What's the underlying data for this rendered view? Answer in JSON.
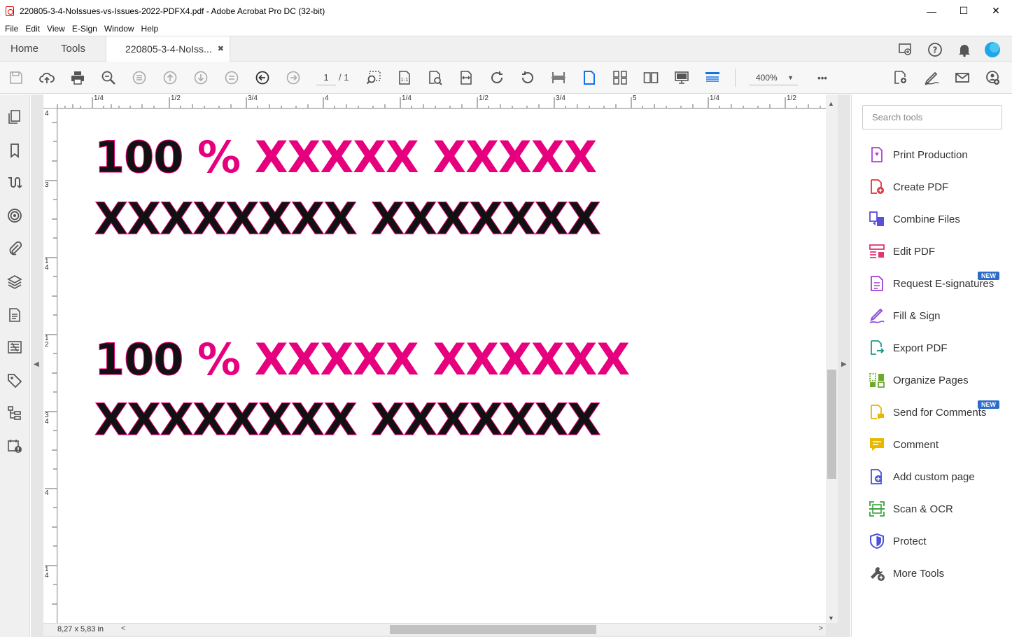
{
  "window": {
    "title": "220805-3-4-NoIssues-vs-Issues-2022-PDFX4.pdf - Adobe Acrobat Pro DC (32-bit)",
    "minimize": "—",
    "maximize": "☐",
    "close": "✕"
  },
  "menu": [
    "File",
    "Edit",
    "View",
    "E-Sign",
    "Window",
    "Help"
  ],
  "tabs": {
    "home": "Home",
    "tools": "Tools",
    "document": "220805-3-4-NoIss...",
    "document_close": "✖"
  },
  "toolbar": {
    "page_current": "1",
    "page_total": "/ 1",
    "zoom": "400%",
    "more": "•••"
  },
  "rulers": {
    "horizontal": [
      "1/4",
      "1/2",
      "3/4",
      "4",
      "1/4",
      "1/2",
      "3/4",
      "5",
      "1/4",
      "1/2"
    ],
    "vertical": [
      "4",
      "3",
      "1\n4",
      "1\n2",
      "3\n4",
      "4",
      "1\n4"
    ]
  },
  "document": {
    "lines": [
      {
        "dark": "100",
        "pink": " % XXXXX XXXXX"
      },
      {
        "dark": "XXXXXXXX XXXXXXX",
        "pink": ""
      },
      {
        "dark": "100",
        "pink": " % XXXXX XXXXXX"
      },
      {
        "dark": "XXXXXXXX XXXXXXX",
        "pink": ""
      }
    ]
  },
  "status": {
    "dimensions": "8,27 x 5,83 in",
    "scroll_left": "<",
    "scroll_right": ">"
  },
  "right_pane": {
    "search_placeholder": "Search tools",
    "new_badge": "NEW",
    "tools": [
      {
        "label": "Print Production",
        "icon": "print-production-icon",
        "color": "#b13fd6"
      },
      {
        "label": "Create PDF",
        "icon": "create-pdf-icon",
        "color": "#e0343b"
      },
      {
        "label": "Combine Files",
        "icon": "combine-files-icon",
        "color": "#5b4fd8"
      },
      {
        "label": "Edit PDF",
        "icon": "edit-pdf-icon",
        "color": "#e03474"
      },
      {
        "label": "Request E-signatures",
        "icon": "request-esignatures-icon",
        "color": "#a23fd6",
        "badge": true
      },
      {
        "label": "Fill & Sign",
        "icon": "fill-sign-icon",
        "color": "#8b4fd8"
      },
      {
        "label": "Export PDF",
        "icon": "export-pdf-icon",
        "color": "#1e9a8a"
      },
      {
        "label": "Organize Pages",
        "icon": "organize-pages-icon",
        "color": "#6cab2a"
      },
      {
        "label": "Send for Comments",
        "icon": "send-for-comments-icon",
        "color": "#e8b800",
        "badge": true
      },
      {
        "label": "Comment",
        "icon": "comment-icon",
        "color": "#e8b800"
      },
      {
        "label": "Add custom page",
        "icon": "add-custom-page-icon",
        "color": "#4b52d8"
      },
      {
        "label": "Scan & OCR",
        "icon": "scan-ocr-icon",
        "color": "#3ca43c"
      },
      {
        "label": "Protect",
        "icon": "protect-icon",
        "color": "#4b52d8"
      },
      {
        "label": "More Tools",
        "icon": "more-tools-icon",
        "color": "#555555"
      }
    ]
  },
  "colors": {
    "accent_pink": "#e6007e",
    "text_dark": "#111111",
    "active_blue": "#1473e6"
  }
}
